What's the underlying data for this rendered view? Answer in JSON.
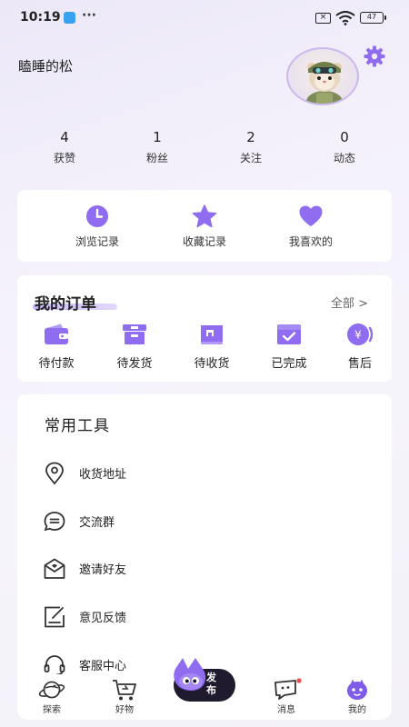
{
  "status_bar": {
    "time": "10:19",
    "dots": "···",
    "battery": "47"
  },
  "profile": {
    "username": "瞌睡的松",
    "avatar_icon": "hamster-avatar",
    "settings_icon": "gear-icon"
  },
  "stats": [
    {
      "count": "4",
      "label": "获赞"
    },
    {
      "count": "1",
      "label": "粉丝"
    },
    {
      "count": "2",
      "label": "关注"
    },
    {
      "count": "0",
      "label": "动态"
    }
  ],
  "quick_links": [
    {
      "label": "浏览记录",
      "icon": "clock-icon"
    },
    {
      "label": "收藏记录",
      "icon": "star-icon"
    },
    {
      "label": "我喜欢的",
      "icon": "heart-icon"
    }
  ],
  "orders": {
    "title": "我的订单",
    "view_all": "全部 >",
    "items": [
      {
        "label": "待付款",
        "icon": "wallet-icon"
      },
      {
        "label": "待发货",
        "icon": "box-icon"
      },
      {
        "label": "待收货",
        "icon": "truck-icon"
      },
      {
        "label": "已完成",
        "icon": "check-box-icon"
      },
      {
        "label": "售后",
        "icon": "yuan-icon"
      }
    ]
  },
  "tools": {
    "title": "常用工具",
    "items": [
      {
        "label": "收货地址",
        "icon": "location-icon"
      },
      {
        "label": "交流群",
        "icon": "chat-icon"
      },
      {
        "label": "邀请好友",
        "icon": "mail-icon"
      },
      {
        "label": "意见反馈",
        "icon": "feedback-icon"
      },
      {
        "label": "客服中心",
        "icon": "headset-icon"
      }
    ]
  },
  "bottom_nav": {
    "items": [
      {
        "label": "探索",
        "icon": "planet-icon"
      },
      {
        "label": "好物",
        "icon": "cart-icon"
      },
      {
        "label": "消息",
        "icon": "message-icon"
      },
      {
        "label": "我的",
        "icon": "profile-face-icon"
      }
    ],
    "publish_label": "发布"
  },
  "colors": {
    "accent": "#8f6cf0",
    "accent_light": "#c8b6f6",
    "publish_bg": "#1f1a2e",
    "badge": "#f24c4c"
  }
}
